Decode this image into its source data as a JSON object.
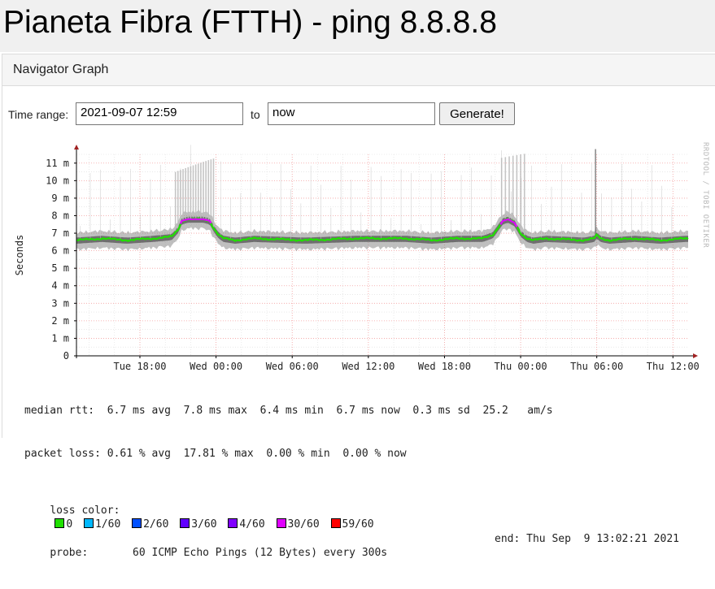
{
  "page": {
    "title": "Pianeta Fibra (FTTH) - ping 8.8.8.8"
  },
  "panel": {
    "header": "Navigator Graph"
  },
  "form": {
    "time_range_label": "Time range:",
    "start_value": "2021-09-07 12:59",
    "to_label": "to",
    "end_value": "now",
    "generate_label": "Generate!"
  },
  "chart_data": {
    "type": "line",
    "ylabel": "Seconds",
    "ylim": [
      0,
      11.5
    ],
    "y_ticks": [
      "0",
      "1 m",
      "2 m",
      "3 m",
      "4 m",
      "5 m",
      "6 m",
      "7 m",
      "8 m",
      "9 m",
      "10 m",
      "11 m"
    ],
    "y_tick_values": [
      0,
      1,
      2,
      3,
      4,
      5,
      6,
      7,
      8,
      9,
      10,
      11
    ],
    "x_ticks": [
      "Tue 18:00",
      "Wed 00:00",
      "Wed 06:00",
      "Wed 12:00",
      "Wed 18:00",
      "Thu 00:00",
      "Thu 06:00",
      "Thu 12:00"
    ],
    "x_tick_hours": [
      5,
      11,
      17,
      23,
      29,
      35,
      41,
      47
    ],
    "x_range_hours": [
      0,
      48.2
    ],
    "series": [
      {
        "name": "median rtt",
        "unit": "ms",
        "x_hours": [
          0,
          2,
          4,
          6,
          7.5,
          8,
          8.3,
          8.8,
          9.5,
          10,
          10.5,
          10.8,
          11.2,
          11.6,
          12.5,
          14,
          18,
          22,
          26,
          28,
          30,
          32,
          32.8,
          33.2,
          33.6,
          34,
          34.5,
          35,
          35.5,
          36,
          37,
          40,
          40.8,
          41,
          41.3,
          42,
          44,
          46,
          48
        ],
        "values_ms": [
          6.6,
          6.7,
          6.6,
          6.7,
          6.8,
          7.2,
          7.7,
          7.8,
          7.8,
          7.8,
          7.7,
          7.3,
          6.9,
          6.7,
          6.6,
          6.7,
          6.6,
          6.7,
          6.7,
          6.6,
          6.7,
          6.7,
          6.9,
          7.3,
          7.7,
          7.8,
          7.6,
          7.0,
          6.7,
          6.6,
          6.7,
          6.6,
          6.7,
          6.9,
          6.7,
          6.6,
          6.7,
          6.6,
          6.7
        ]
      }
    ],
    "spike_hours": [
      7.8,
      8.0,
      8.2,
      8.4,
      8.6,
      8.8,
      9.0,
      9.2,
      9.4,
      9.6,
      9.8,
      10.0,
      10.2,
      10.4,
      10.6,
      10.8,
      33.5,
      33.8,
      34.1,
      34.4,
      34.7,
      35.0,
      35.3,
      40.9
    ],
    "loss_colors": [
      "#20e000",
      "#00b8ff",
      "#0050ff",
      "#6000ff",
      "#8000ff",
      "#e000ff",
      "#ff0000"
    ],
    "colors": {
      "median_line": "#20e000",
      "high_loss_line": "#e000ff",
      "smoke": "#000000",
      "grid_major": "#f4a0a0",
      "grid_minor": "#dcdcdc",
      "axis": "#000000",
      "arrow": "#a02020"
    }
  },
  "legend": {
    "median": "median rtt:  6.7 ms avg  7.8 ms max  6.4 ms min  6.7 ms now  0.3 ms sd  25.2   am/s",
    "loss": "packet loss: 0.61 % avg  17.81 % max  0.00 % min  0.00 % now",
    "loss_color_label": "loss color:",
    "loss_items": [
      {
        "label": "0",
        "color": "#20e000"
      },
      {
        "label": "1/60",
        "color": "#00b8ff"
      },
      {
        "label": "2/60",
        "color": "#0050ff"
      },
      {
        "label": "3/60",
        "color": "#6000ff"
      },
      {
        "label": "4/60",
        "color": "#8000ff"
      },
      {
        "label": "30/60",
        "color": "#e000ff"
      },
      {
        "label": "59/60",
        "color": "#ff0000"
      }
    ],
    "probe": "probe:       60 ICMP Echo Pings (12 Bytes) every 300s",
    "end": "end: Thu Sep  9 13:02:21 2021"
  },
  "watermark": "RRDTOOL / TOBI OETIKER"
}
